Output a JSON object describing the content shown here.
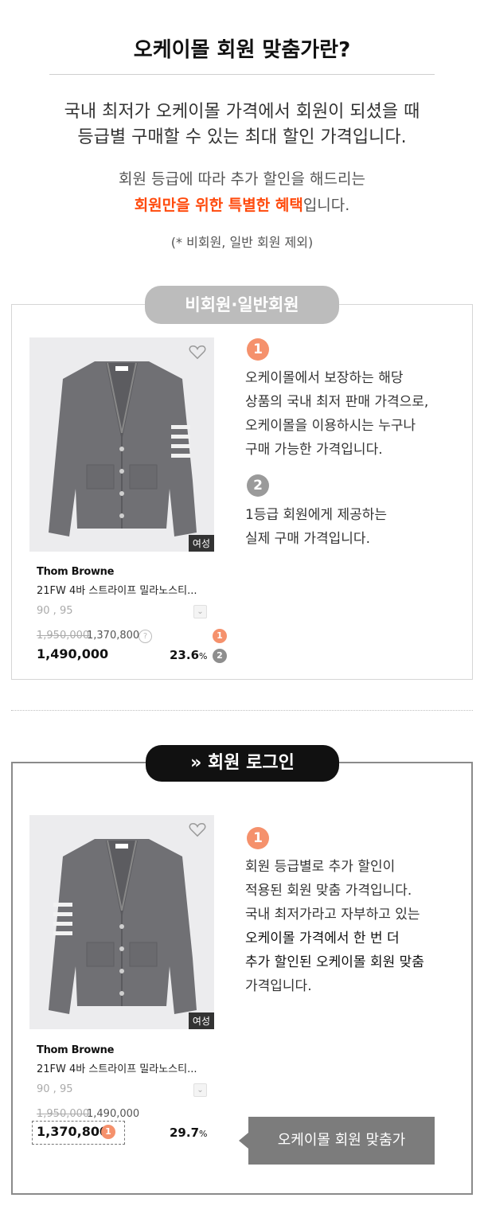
{
  "header": {
    "title": "오케이몰 회원 맞춤가란?",
    "lead_line1": "국내 최저가 오케이몰 가격에서 회원이 되셨을 때",
    "lead_line2": "등급별 구매할 수 있는 최대 할인 가격입니다.",
    "sub_line1": "회원 등급에 따라 추가 할인을 해드리는",
    "sub_highlight": "회원만을 위한 특별한 혜택",
    "sub_tail": "입니다.",
    "note": "(* 비회원, 일반 회원 제외)"
  },
  "section1": {
    "pill": "비회원·일반회원",
    "product": {
      "tag": "여성",
      "brand": "Thom Browne",
      "name": "21FW  4바 스트라이프 밀라노스티...",
      "sizes": "90 , 95",
      "original_price": "1,950,000",
      "secondary_price": "1,370,800",
      "price": "1,490,000",
      "discount": "23.6",
      "discount_unit": "%"
    },
    "badges": [
      "1",
      "2"
    ],
    "desc1": [
      "오케이몰에서 보장하는 해당",
      "상품의 국내 최저 판매 가격으로,",
      "오케이몰을 이용하시는 누구나",
      "구매 가능한 가격입니다."
    ],
    "desc2": [
      "1등급 회원에게 제공하는",
      "실제 구매 가격입니다."
    ]
  },
  "section2": {
    "pill_icon": "»",
    "pill": "회원 로그인",
    "product": {
      "tag": "여성",
      "brand": "Thom Browne",
      "name": "21FW  4바 스트라이프 밀라노스티...",
      "sizes": "90 , 95",
      "original_price": "1,950,000",
      "secondary_price": "1,490,000",
      "price": "1,370,800",
      "discount": "29.7",
      "discount_unit": "%"
    },
    "badge": "1",
    "desc": [
      "회원 등급별로 추가 할인이",
      "적용된 회원 맞춤 가격입니다.",
      "국내 최저가라고 자부하고 있는",
      "오케이몰 가격에서 한 번 더",
      "추가 할인된 오케이몰 회원 맞춤",
      "가격입니다."
    ],
    "callout": "오케이몰 회원 맞춤가"
  },
  "colors": {
    "accent": "#ff4a0c",
    "badge_orange": "#f5916c",
    "badge_gray": "#8e8e8e"
  },
  "icons": [
    "heart-icon",
    "chevron-down-icon",
    "question-icon"
  ]
}
